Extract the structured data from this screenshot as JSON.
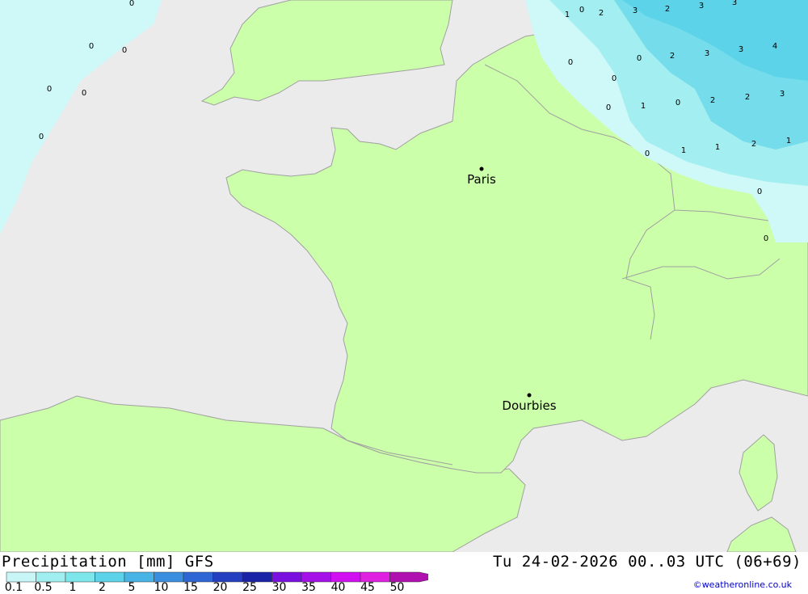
{
  "map": {
    "cities": [
      {
        "name": "Paris"
      },
      {
        "name": "Dourbies"
      }
    ],
    "precip_values": [
      "0",
      "0",
      "0",
      "0",
      "0",
      "0",
      "0",
      "0",
      "1",
      "2",
      "3",
      "2",
      "3",
      "3",
      "0",
      "2",
      "3",
      "3",
      "4",
      "1",
      "0",
      "2",
      "2",
      "3",
      "0",
      "1",
      "1",
      "2",
      "1",
      "0",
      "0",
      "0",
      "0"
    ]
  },
  "footer": {
    "title": "Precipitation [mm] GFS",
    "datetime": "Tu 24-02-2026 00..03 UTC (06+69)",
    "credit": "©weatheronline.co.uk"
  },
  "legend": {
    "labels": [
      "0.1",
      "0.5",
      "1",
      "2",
      "5",
      "10",
      "15",
      "20",
      "25",
      "30",
      "35",
      "40",
      "45",
      "50"
    ],
    "colors": [
      "#c8f5f6",
      "#a0eef0",
      "#7de6ea",
      "#5cd3e8",
      "#48b4e6",
      "#3a8ee0",
      "#2f66d6",
      "#2440c0",
      "#1a22a8",
      "#7a10e0",
      "#a610e8",
      "#d010f0",
      "#e020e0",
      "#b010b0"
    ]
  },
  "colors": {
    "sea": "#ebebeb",
    "land": "#ccffaa",
    "border": "#a0a0a0",
    "precip_light": "#cff8f8",
    "precip_mid": "#a2eef0",
    "precip_high": "#74dcea"
  }
}
